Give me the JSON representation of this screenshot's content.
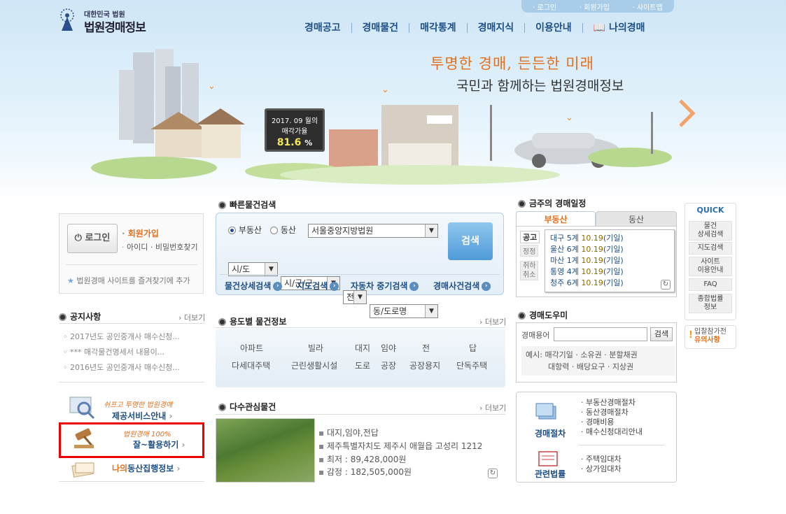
{
  "top_links": [
    "로그인",
    "회원가입",
    "사이트맵"
  ],
  "logo": {
    "line1": "대한민국 법원",
    "line2": "법원경매정보"
  },
  "gnb": [
    "경매공고",
    "경매물건",
    "매각통계",
    "경매지식",
    "이용안내",
    "나의경매"
  ],
  "hero": {
    "slogan1": "투명한 경매, 든든한 미래",
    "slogan2": "국민과 함께하는 법원경매정보",
    "sign_line1": "2017. 09 월의",
    "sign_line2": "매각가율",
    "sign_value": "81.6",
    "sign_unit": "%"
  },
  "login": {
    "button": "로그인",
    "join": "회원가입",
    "find": "아이디 · 비밀번호찾기",
    "bookmark": "법원경매 사이트를 즐겨찾기에 추가"
  },
  "notice": {
    "title": "공지사항",
    "more": "더보기",
    "items": [
      "2017년도 공인중개사 매수신청...",
      "*** 매각물건명세서 내용이...",
      "2016년도 공인중개사 매수신청..."
    ]
  },
  "promos": {
    "p1_sub": "쉬프고 투명한 법원경매",
    "p1": "제공서비스안내",
    "p2_sub": "법원경매 100%",
    "p2": "잘~활용하기",
    "p3_prefix": "나의",
    "p3": "동산집행정보"
  },
  "quick_search": {
    "title": "빠른물건검색",
    "radio1": "부동산",
    "radio2": "동산",
    "court": "서울중앙지방법원",
    "sido": "시/도",
    "sigungu": "시/군/구",
    "jeon": "전",
    "dong": "동/도로명",
    "search": "검색",
    "tabs": [
      "물건상세검색",
      "지도검색",
      "자동차 중기검색",
      "경매사건검색"
    ]
  },
  "usage": {
    "title": "용도별 물건정보",
    "more": "더보기",
    "row1": [
      "아파트",
      "빌라",
      "대지",
      "임야",
      "전",
      "답"
    ],
    "row2": [
      "다세대주택",
      "근린생활시설",
      "도로",
      "공장",
      "공장용지",
      "단독주택"
    ]
  },
  "interest": {
    "title": "다수관심물건",
    "more": "더보기",
    "type": "대지,임야,전답",
    "address": "제주특별자치도 제주시 애월읍 고성리 1212",
    "min": "최저 : 89,428,000원",
    "appraisal": "감정 : 182,505,000원"
  },
  "schedule": {
    "title": "금주의 경매일정",
    "tab1": "부동산",
    "tab2": "동산",
    "side": [
      "공고",
      "정정",
      "취하\n취소"
    ],
    "items": [
      {
        "place": "대구 5계",
        "date": "10.19",
        "type": "(기일)"
      },
      {
        "place": "울산 6계",
        "date": "10.19",
        "type": "(기일)"
      },
      {
        "place": "마산 1계",
        "date": "10.19",
        "type": "(기일)"
      },
      {
        "place": "통영 4계",
        "date": "10.19",
        "type": "(기일)"
      },
      {
        "place": "청주 6계",
        "date": "10.19",
        "type": "(기일)"
      }
    ]
  },
  "dictionary": {
    "title": "경매도우미",
    "label": "경매용어",
    "button": "검색",
    "ex_line1": "예시: 매각기일 · 소유권 · 분할채권",
    "ex_line2": "대항력 · 배당요구 · 지상권"
  },
  "procedure": {
    "title1": "경매절차",
    "links1": [
      "부동산경매절차",
      "동산경매절차",
      "경매비용",
      "매수신청대리안내"
    ],
    "title2": "관련법률",
    "links2": [
      "주택임대차",
      "상가임대차"
    ]
  },
  "quick": {
    "title": "QUICK",
    "items": [
      "물건\n상세검색",
      "지도검색",
      "사이트\n이용안내",
      "FAQ",
      "종합법률\n정보"
    ],
    "bid1": "입찰참가전",
    "bid2": "유의사항"
  }
}
